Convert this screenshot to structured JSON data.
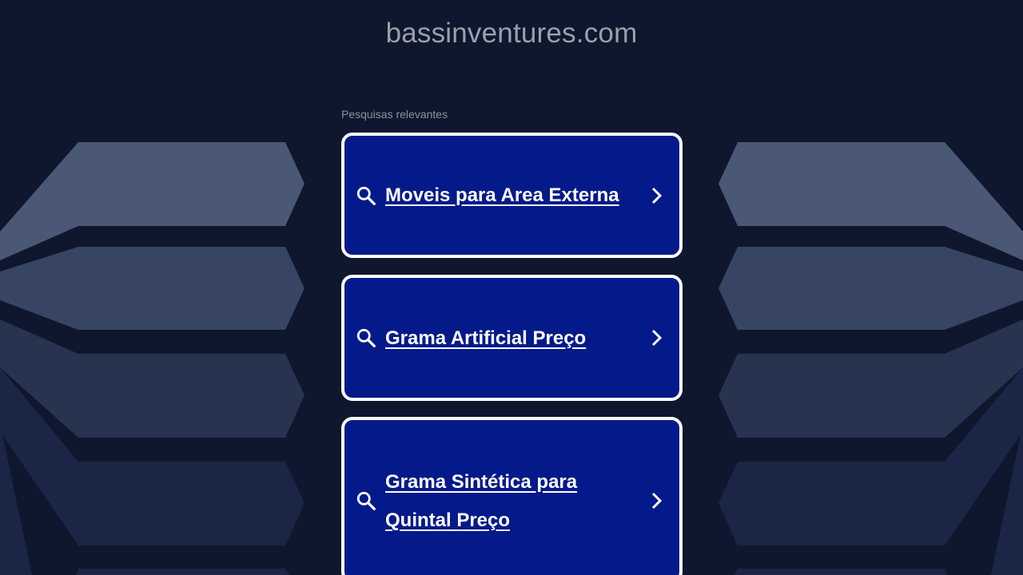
{
  "header": {
    "domain": "bassinventures.com"
  },
  "related": {
    "label": "Pesquisas relevantes",
    "items": [
      {
        "label": "Moveis para Area Externa",
        "icon": "search-icon",
        "action_icon": "chevron-right-icon"
      },
      {
        "label": "Grama Artificial Preço",
        "icon": "search-icon",
        "action_icon": "chevron-right-icon"
      },
      {
        "label": "Grama Sintética para Quintal Preço",
        "icon": "search-icon",
        "action_icon": "chevron-right-icon"
      }
    ]
  },
  "colors": {
    "background": "#0e172d",
    "card_background": "#041a8a",
    "card_border": "#ffffff",
    "domain_text": "#9aa0ab",
    "label_text": "#8c909a"
  }
}
